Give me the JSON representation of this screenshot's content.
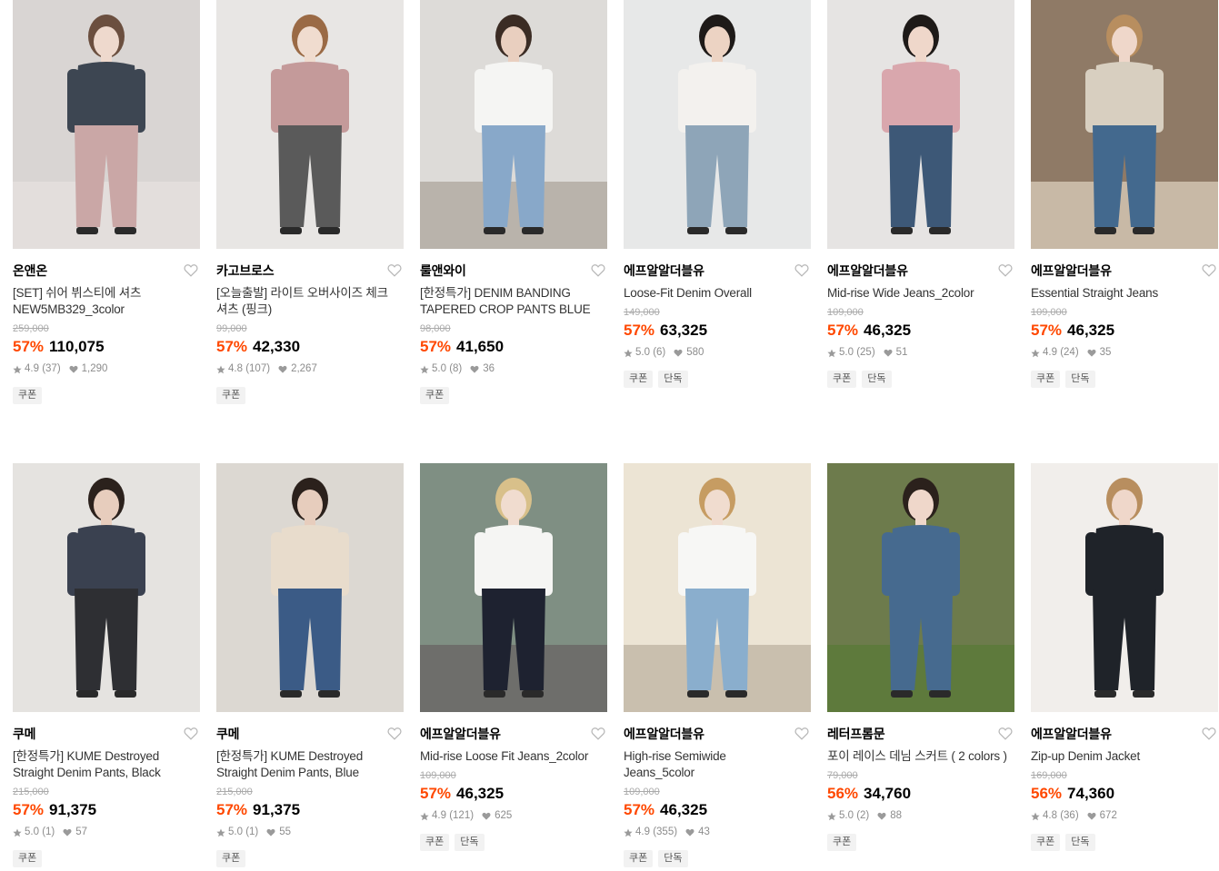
{
  "accent_color": "#ff4800",
  "products": [
    {
      "brand": "온앤온",
      "name": [
        "[SET] 쉬어 뷔스티에 셔츠",
        "NEW5MB329_3color"
      ],
      "original_price": "259,000",
      "discount": "57%",
      "price": "110,075",
      "rating": "4.9",
      "reviews": "(37)",
      "likes": "1,290",
      "tags": [
        "쿠폰"
      ]
    },
    {
      "brand": "카고브로스",
      "name": [
        "[오늘출발] 라이트 오버사이즈 체크",
        "셔츠 (핑크)"
      ],
      "original_price": "99,000",
      "discount": "57%",
      "price": "42,330",
      "rating": "4.8",
      "reviews": "(107)",
      "likes": "2,267",
      "tags": [
        "쿠폰"
      ]
    },
    {
      "brand": "룰앤와이",
      "name": [
        "[한정특가] DENIM BANDING",
        "TAPERED CROP PANTS BLUE"
      ],
      "original_price": "98,000",
      "discount": "57%",
      "price": "41,650",
      "rating": "5.0",
      "reviews": "(8)",
      "likes": "36",
      "tags": [
        "쿠폰"
      ]
    },
    {
      "brand": "에프알알더블유",
      "name": [
        "Loose-Fit Denim Overall"
      ],
      "original_price": "149,000",
      "discount": "57%",
      "price": "63,325",
      "rating": "5.0",
      "reviews": "(6)",
      "likes": "580",
      "tags": [
        "쿠폰",
        "단독"
      ]
    },
    {
      "brand": "에프알알더블유",
      "name": [
        "Mid-rise Wide Jeans_2color"
      ],
      "original_price": "109,000",
      "discount": "57%",
      "price": "46,325",
      "rating": "5.0",
      "reviews": "(25)",
      "likes": "51",
      "tags": [
        "쿠폰",
        "단독"
      ]
    },
    {
      "brand": "에프알알더블유",
      "name": [
        "Essential Straight Jeans"
      ],
      "original_price": "109,000",
      "discount": "57%",
      "price": "46,325",
      "rating": "4.9",
      "reviews": "(24)",
      "likes": "35",
      "tags": [
        "쿠폰",
        "단독"
      ]
    },
    {
      "brand": "쿠메",
      "name": [
        "[한정특가] KUME Destroyed",
        "Straight Denim Pants, Black"
      ],
      "original_price": "215,000",
      "discount": "57%",
      "price": "91,375",
      "rating": "5.0",
      "reviews": "(1)",
      "likes": "57",
      "tags": [
        "쿠폰"
      ]
    },
    {
      "brand": "쿠메",
      "name": [
        "[한정특가] KUME Destroyed",
        "Straight Denim Pants, Blue"
      ],
      "original_price": "215,000",
      "discount": "57%",
      "price": "91,375",
      "rating": "5.0",
      "reviews": "(1)",
      "likes": "55",
      "tags": [
        "쿠폰"
      ]
    },
    {
      "brand": "에프알알더블유",
      "name": [
        "Mid-rise Loose Fit Jeans_2color"
      ],
      "original_price": "109,000",
      "discount": "57%",
      "price": "46,325",
      "rating": "4.9",
      "reviews": "(121)",
      "likes": "625",
      "tags": [
        "쿠폰",
        "단독"
      ]
    },
    {
      "brand": "에프알알더블유",
      "name": [
        "High-rise Semiwide",
        "Jeans_5color"
      ],
      "original_price": "109,000",
      "discount": "57%",
      "price": "46,325",
      "rating": "4.9",
      "reviews": "(355)",
      "likes": "43",
      "tags": [
        "쿠폰",
        "단독"
      ]
    },
    {
      "brand": "레터프롬문",
      "name": [
        "포이 레이스 데님 스커트 ( 2 colors )"
      ],
      "original_price": "79,000",
      "discount": "56%",
      "price": "34,760",
      "rating": "5.0",
      "reviews": "(2)",
      "likes": "88",
      "tags": [
        "쿠폰"
      ]
    },
    {
      "brand": "에프알알더블유",
      "name": [
        "Zip-up Denim Jacket"
      ],
      "original_price": "169,000",
      "discount": "56%",
      "price": "74,360",
      "rating": "4.8",
      "reviews": "(36)",
      "likes": "672",
      "tags": [
        "쿠폰",
        "단독"
      ]
    }
  ],
  "images": [
    {
      "bg": "#d9d5d3",
      "floor": "#e3dedc",
      "top": "#3d4652",
      "bottom": "#caa7a6",
      "skin": "#eed9cd",
      "hair": "#6b4f3f"
    },
    {
      "bg": "#e8e6e4",
      "floor": "#e8e6e4",
      "top": "#c49a9a",
      "bottom": "#5a5a5a",
      "skin": "#f0dccf",
      "hair": "#9a6a45"
    },
    {
      "bg": "#dddbd8",
      "floor": "#b9b3ab",
      "top": "#f5f5f3",
      "bottom": "#88a8c9",
      "skin": "#e9cfbf",
      "hair": "#3b2c24"
    },
    {
      "bg": "#e7e8e8",
      "floor": "#e7e8e8",
      "top": "#f3f1ee",
      "bottom": "#8ea5b8",
      "skin": "#ecd3c3",
      "hair": "#1e1a18"
    },
    {
      "bg": "#e6e4e3",
      "floor": "#e6e4e3",
      "top": "#d9a7ad",
      "bottom": "#3d5877",
      "skin": "#efd7ca",
      "hair": "#1e1a18"
    },
    {
      "bg": "#8f7a66",
      "floor": "#c8b9a6",
      "top": "#d8cfc0",
      "bottom": "#43698e",
      "skin": "#efd7ca",
      "hair": "#b88e5f"
    },
    {
      "bg": "#e5e3e0",
      "floor": "#e5e3e0",
      "top": "#3a4150",
      "bottom": "#2e2f33",
      "skin": "#e7cdbd",
      "hair": "#2b211c"
    },
    {
      "bg": "#dcd8d2",
      "floor": "#dcd8d2",
      "top": "#e8dccc",
      "bottom": "#3b5b86",
      "skin": "#e7cdbd",
      "hair": "#2b211c"
    },
    {
      "bg": "#7f8f83",
      "floor": "#6e6e6b",
      "top": "#f5f5f3",
      "bottom": "#1e2230",
      "skin": "#f0dccf",
      "hair": "#d8c08a"
    },
    {
      "bg": "#ece4d4",
      "floor": "#c9bfae",
      "top": "#f7f7f5",
      "bottom": "#8aaecd",
      "skin": "#f0dccf",
      "hair": "#c69c62"
    },
    {
      "bg": "#6d7b4c",
      "floor": "#5e7a3c",
      "top": "#466a8f",
      "bottom": "#466a8f",
      "skin": "#efd7ca",
      "hair": "#2b211c"
    },
    {
      "bg": "#f1eeeb",
      "floor": "#f1eeeb",
      "top": "#1f2329",
      "bottom": "#1f2329",
      "skin": "#efd7ca",
      "hair": "#b88e5f"
    }
  ]
}
